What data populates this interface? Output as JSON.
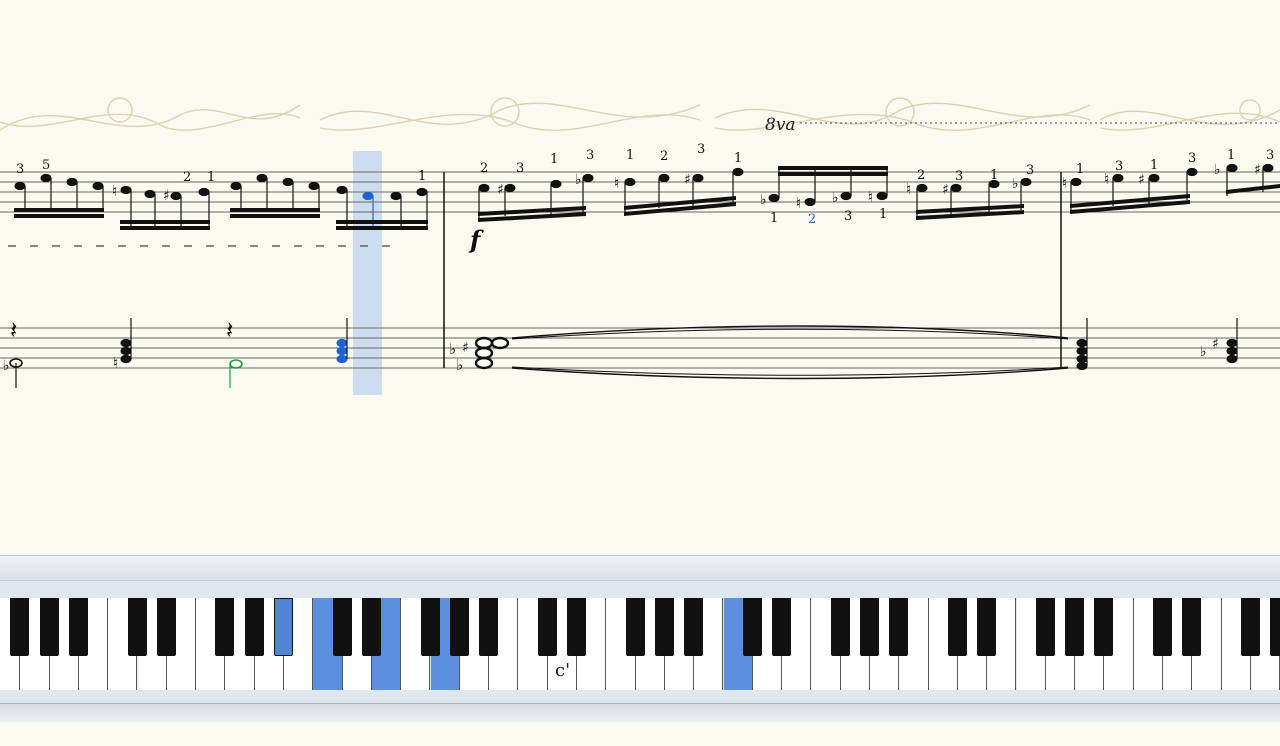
{
  "score": {
    "octave_marking": "8va",
    "dynamic": "f",
    "fingerings": [
      "3",
      "5",
      "2",
      "1",
      "1",
      "2",
      "3",
      "1",
      "3",
      "1",
      "2",
      "3",
      "1",
      "2",
      "3",
      "1",
      "1",
      "2",
      "3",
      "1",
      "3",
      "1",
      "3",
      "1",
      "3",
      "1",
      "3",
      "1"
    ]
  },
  "keyboard": {
    "middle_c_label": "c'"
  },
  "colors": {
    "paper": "#fbfaf0",
    "highlight": "#c5d6ee",
    "active_note": "#1f63d1",
    "prev_note": "#1d9b3f",
    "key_active": "#5b8fde"
  }
}
